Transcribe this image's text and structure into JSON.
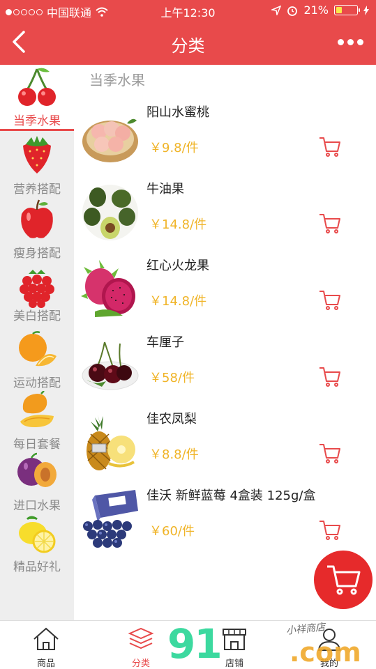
{
  "status_bar": {
    "carrier": "中国联通",
    "time": "上午12:30",
    "battery_percent": "21%"
  },
  "navbar": {
    "title": "分类"
  },
  "sidebar": {
    "items": [
      {
        "label": "当季水果",
        "icon": "cherry-icon",
        "active": true
      },
      {
        "label": "营养搭配",
        "icon": "strawberry-icon",
        "active": false
      },
      {
        "label": "瘦身搭配",
        "icon": "apple-icon",
        "active": false
      },
      {
        "label": "美白搭配",
        "icon": "raspberry-icon",
        "active": false
      },
      {
        "label": "运动搭配",
        "icon": "orange-icon",
        "active": false
      },
      {
        "label": "每日套餐",
        "icon": "mango-icon",
        "active": false
      },
      {
        "label": "进口水果",
        "icon": "plum-icon",
        "active": false
      },
      {
        "label": "精品好礼",
        "icon": "lemon-icon",
        "active": false
      }
    ]
  },
  "section": {
    "title": "当季水果"
  },
  "products": [
    {
      "name": "阳山水蜜桃",
      "price": "￥9.8/件",
      "image": "peach-image"
    },
    {
      "name": "牛油果",
      "price": "￥14.8/件",
      "image": "avocado-image"
    },
    {
      "name": "红心火龙果",
      "price": "￥14.8/件",
      "image": "dragonfruit-image"
    },
    {
      "name": "车厘子",
      "price": "￥58/件",
      "image": "cherry-image"
    },
    {
      "name": "佳农凤梨",
      "price": "￥8.8/件",
      "image": "pineapple-image"
    },
    {
      "name": "佳沃 新鲜蓝莓 4盒装 125g/盒",
      "price": "￥60/件",
      "image": "blueberry-image"
    }
  ],
  "tabbar": {
    "items": [
      {
        "label": "商品",
        "icon": "home-icon",
        "active": false
      },
      {
        "label": "分类",
        "icon": "layers-icon",
        "active": true
      },
      {
        "label": "店铺",
        "icon": "shop-icon",
        "active": false
      },
      {
        "label": "我的",
        "icon": "user-icon",
        "active": false
      }
    ]
  },
  "watermark": {
    "brand": "91",
    "domain": ".com",
    "signature": "小祥商店"
  },
  "colors": {
    "primary": "#e84a4b",
    "price": "#f0b428",
    "sidebar_bg": "#eeeeee"
  }
}
